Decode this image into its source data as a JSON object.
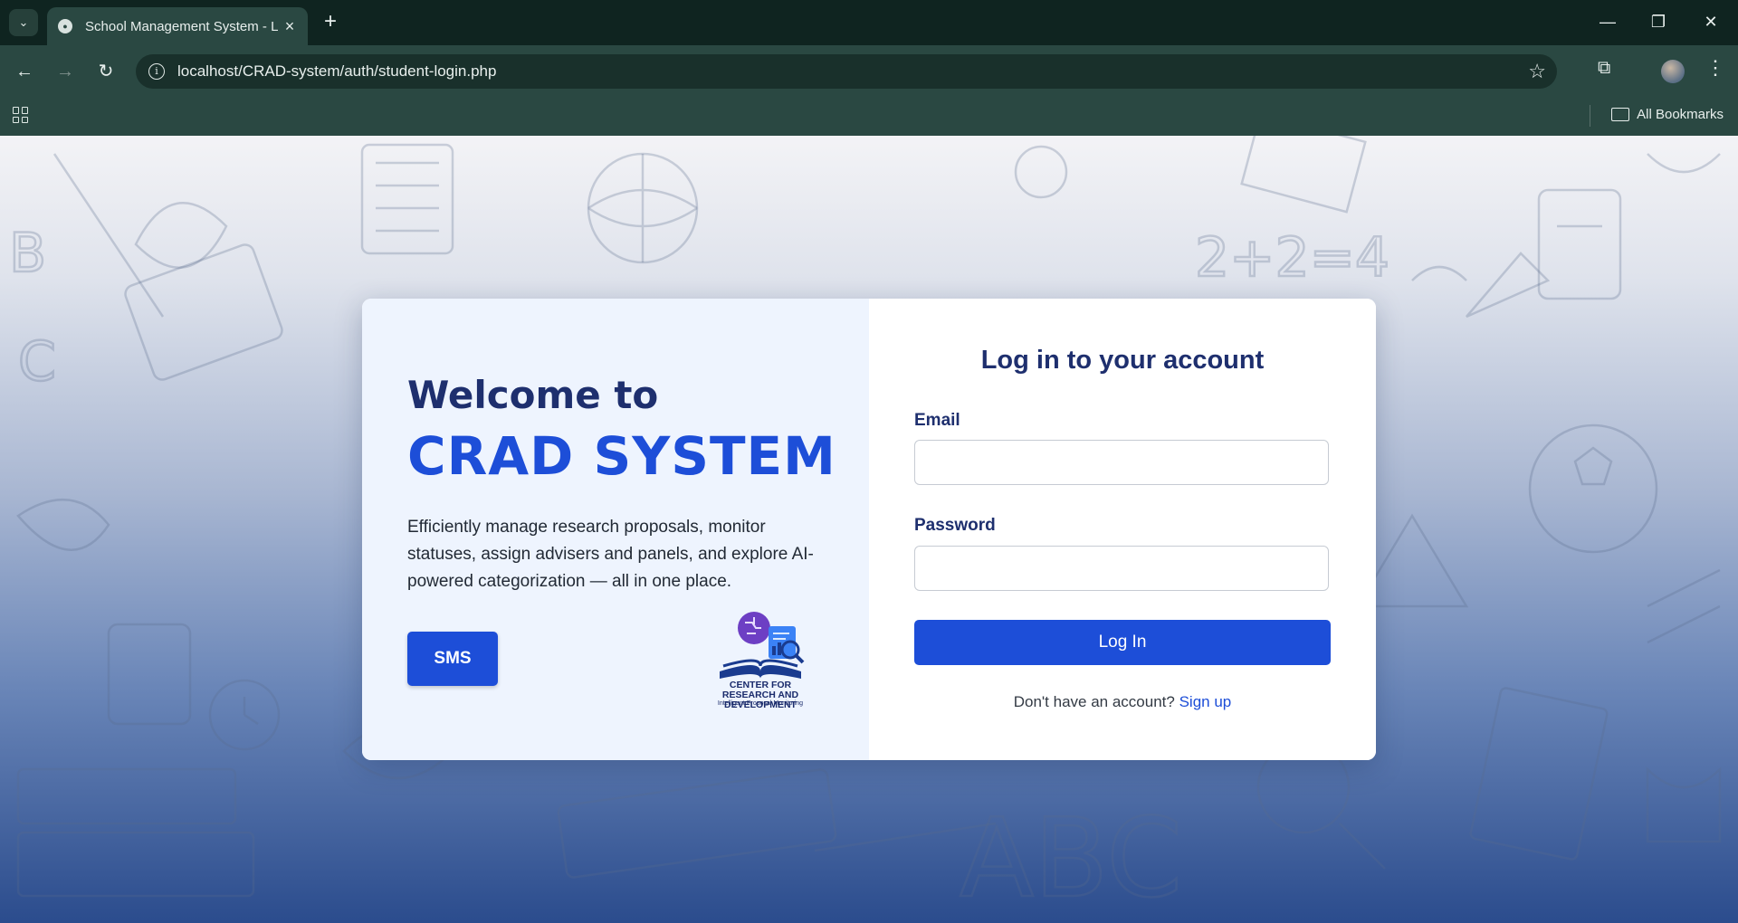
{
  "browser": {
    "tab_title": "School Management System - L",
    "url": "localhost/CRAD-system/auth/student-login.php",
    "bookmarks_label": "All Bookmarks"
  },
  "welcome": {
    "line1": "Welcome to",
    "line2": "CRAD SYSTEM",
    "description": "Efficiently manage research proposals, monitor statuses, assign advisers and panels, and explore AI-powered categorization — all in one place.",
    "sms_button": "SMS",
    "logo_text_1": "CENTER FOR",
    "logo_text_2": "RESEARCH AND DEVELOPMENT",
    "logo_text_3": "Intelligent Proposal Monitoring"
  },
  "login": {
    "title": "Log in to your account",
    "email_label": "Email",
    "email_value": "",
    "password_label": "Password",
    "password_value": "",
    "submit_label": "Log In",
    "signup_prompt": "Don't have an account?",
    "signup_link": "Sign up"
  },
  "colors": {
    "primary": "#1d4ed8",
    "heading": "#1e2f6e",
    "chrome": "#2a4842"
  }
}
